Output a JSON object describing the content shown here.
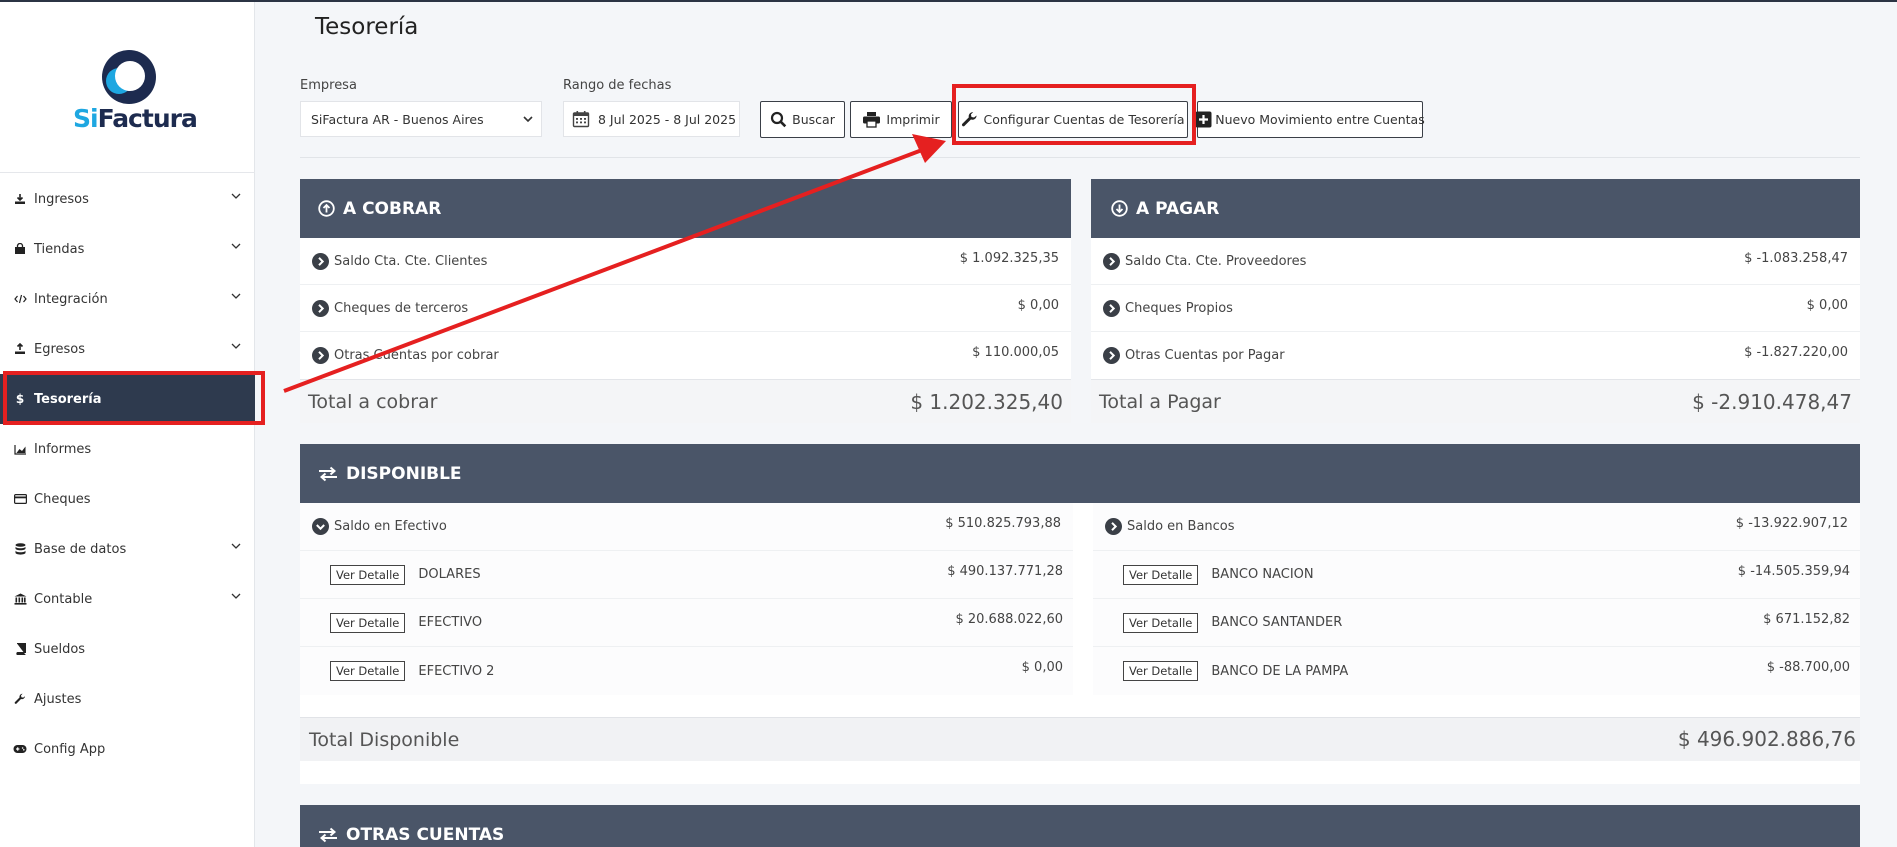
{
  "sidebar": {
    "logo": {
      "part1": "Si",
      "part2": "Factura"
    },
    "items": [
      {
        "label": "Ingresos",
        "icon": "download-icon",
        "expandable": true
      },
      {
        "label": "Tiendas",
        "icon": "shopping-bag-icon",
        "expandable": true
      },
      {
        "label": "Integración",
        "icon": "code-icon",
        "expandable": true
      },
      {
        "label": "Egresos",
        "icon": "upload-icon",
        "expandable": true
      },
      {
        "label": "Tesorería",
        "icon": "dollar-icon",
        "expandable": false,
        "active": true
      },
      {
        "label": "Informes",
        "icon": "chart-area-icon",
        "expandable": false
      },
      {
        "label": "Cheques",
        "icon": "credit-card-icon",
        "expandable": false
      },
      {
        "label": "Base de datos",
        "icon": "database-icon",
        "expandable": true
      },
      {
        "label": "Contable",
        "icon": "bank-icon",
        "expandable": true
      },
      {
        "label": "Sueldos",
        "icon": "book-icon",
        "expandable": false
      },
      {
        "label": "Ajustes",
        "icon": "wrench-icon",
        "expandable": false
      },
      {
        "label": "Config App",
        "icon": "gamepad-icon",
        "expandable": false
      }
    ]
  },
  "header": {
    "title": "Tesorería"
  },
  "filters": {
    "empresa_label": "Empresa",
    "empresa_value": "SiFactura AR - Buenos Aires",
    "rango_label": "Rango de fechas",
    "rango_value": "8 Jul 2025 - 8 Jul 2025"
  },
  "toolbar": {
    "buscar": "Buscar",
    "imprimir": "Imprimir",
    "configurar": "Configurar Cuentas de Tesorería",
    "nuevo": "Nuevo Movimiento entre Cuentas"
  },
  "a_cobrar": {
    "title": "A COBRAR",
    "rows": [
      {
        "label": "Saldo Cta. Cte. Clientes",
        "amount": "$ 1.092.325,35"
      },
      {
        "label": "Cheques de terceros",
        "amount": "$ 0,00"
      },
      {
        "label": "Otras Cuentas por cobrar",
        "amount": "$ 110.000,05"
      }
    ],
    "total_label": "Total a cobrar",
    "total_amount": "$ 1.202.325,40"
  },
  "a_pagar": {
    "title": "A PAGAR",
    "rows": [
      {
        "label": "Saldo Cta. Cte. Proveedores",
        "amount": "$ -1.083.258,47"
      },
      {
        "label": "Cheques Propios",
        "amount": "$ 0,00"
      },
      {
        "label": "Otras Cuentas por Pagar",
        "amount": "$ -1.827.220,00"
      }
    ],
    "total_label": "Total a Pagar",
    "total_amount": "$ -2.910.478,47"
  },
  "disponible": {
    "title": "DISPONIBLE",
    "efectivo": {
      "label": "Saldo en Efectivo",
      "amount": "$ 510.825.793,88",
      "items": [
        {
          "name": "DOLARES",
          "amount": "$ 490.137.771,28"
        },
        {
          "name": "EFECTIVO",
          "amount": "$ 20.688.022,60"
        },
        {
          "name": "EFECTIVO 2",
          "amount": "$ 0,00"
        }
      ]
    },
    "bancos": {
      "label": "Saldo en Bancos",
      "amount": "$ -13.922.907,12",
      "items": [
        {
          "name": "BANCO NACION",
          "amount": "$ -14.505.359,94"
        },
        {
          "name": "BANCO SANTANDER",
          "amount": "$ 671.152,82"
        },
        {
          "name": "BANCO DE LA PAMPA",
          "amount": "$ -88.700,00"
        }
      ]
    },
    "detail_button": "Ver Detalle",
    "total_label": "Total Disponible",
    "total_amount": "$ 496.902.886,76"
  },
  "otras_cuentas": {
    "title": "OTRAS CUENTAS"
  },
  "colors": {
    "header_bg": "#4a5568",
    "sidebar_active": "#2e3a4e",
    "highlight": "#e52020",
    "brand_blue": "#1ea7e1",
    "brand_navy": "#1d2b4f"
  }
}
